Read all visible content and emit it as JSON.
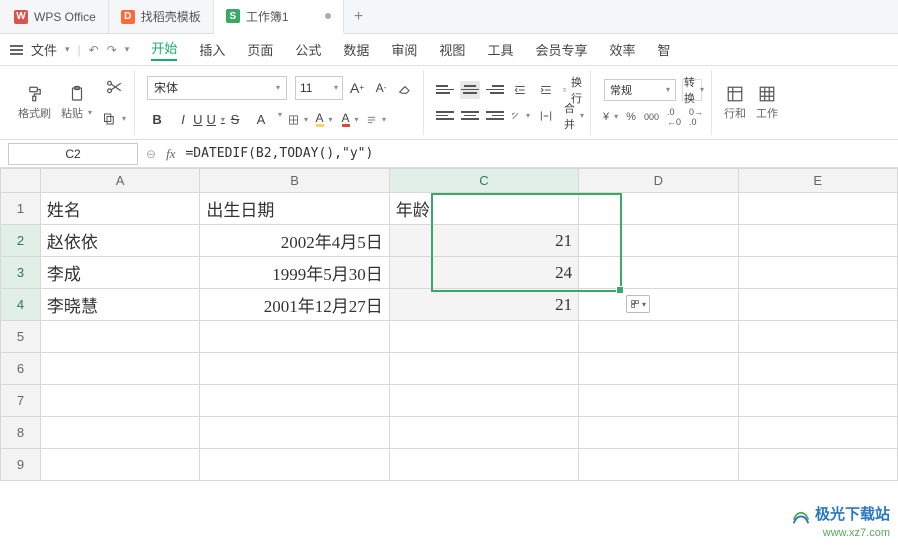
{
  "tabs": {
    "t0": "WPS Office",
    "t1": "找稻壳模板",
    "t2": "工作簿1",
    "add": "+"
  },
  "menu": {
    "file": "文件",
    "start": "开始",
    "insert": "插入",
    "page": "页面",
    "formula": "公式",
    "data": "数据",
    "review": "审阅",
    "view": "视图",
    "tools": "工具",
    "member": "会员专享",
    "efficiency": "效率",
    "smart": "智"
  },
  "ribbon": {
    "format_painter": "格式刷",
    "paste": "粘贴",
    "font_name": "宋体",
    "font_size": "11",
    "wrap": "换行",
    "merge": "合并",
    "num_format": "常规",
    "convert": "转换",
    "rowcol": "行和",
    "worksheet": "工作",
    "currency": "羊",
    "percent": "%",
    "thousand": "000",
    "dec_inc": ".0←",
    "dec_dec": "→.0",
    "bold": "B",
    "italic": "I",
    "underline": "U",
    "strike": "S",
    "font_a": "A",
    "hl_a": "A",
    "clr_a": "A",
    "size_inc": "A+",
    "size_dec": "A-"
  },
  "formula_bar": {
    "cell_ref": "C2",
    "fx": "fx",
    "formula": "=DATEDIF(B2,TODAY(),\"y\")"
  },
  "grid": {
    "cols": {
      "A": "A",
      "B": "B",
      "C": "C",
      "D": "D",
      "E": "E"
    },
    "rows": {
      "r1": "1",
      "r2": "2",
      "r3": "3",
      "r4": "4",
      "r5": "5",
      "r6": "6",
      "r7": "7",
      "r8": "8",
      "r9": "9"
    },
    "headers": {
      "name": "姓名",
      "dob": "出生日期",
      "age": "年龄"
    },
    "data": [
      {
        "name": "赵依依",
        "dob": "2002年4月5日",
        "age": "21"
      },
      {
        "name": "李成",
        "dob": "1999年5月30日",
        "age": "24"
      },
      {
        "name": "李晓慧",
        "dob": "2001年12月27日",
        "age": "21"
      }
    ]
  },
  "watermark": {
    "title": "极光下载站",
    "url": "www.xz7.com"
  },
  "icons": {
    "chevron": "▾",
    "arrow_r": "›"
  }
}
